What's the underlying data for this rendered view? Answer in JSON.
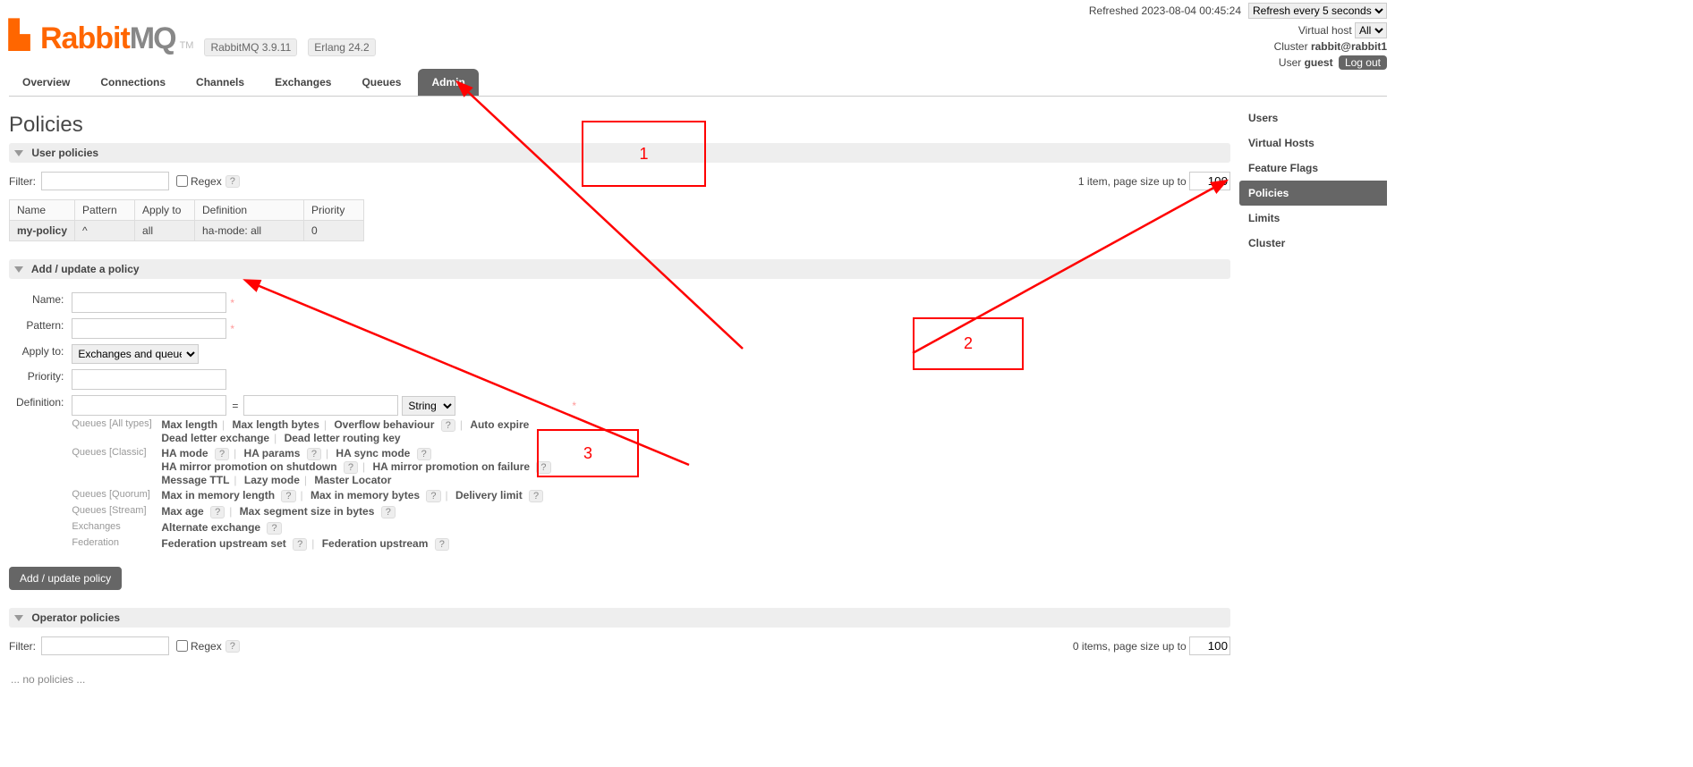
{
  "header": {
    "refreshed_label": "Refreshed 2023-08-04 00:45:24",
    "refresh_select": "Refresh every 5 seconds",
    "vhost_label": "Virtual host",
    "vhost_value": "All",
    "cluster_label": "Cluster",
    "cluster_value": "rabbit@rabbit1",
    "user_label": "User",
    "user_value": "guest",
    "logout": "Log out",
    "rabbit": "Rabbit",
    "mq": "MQ",
    "tm": "TM",
    "version": "RabbitMQ 3.9.11",
    "erlang": "Erlang 24.2"
  },
  "tabs": [
    "Overview",
    "Connections",
    "Channels",
    "Exchanges",
    "Queues",
    "Admin"
  ],
  "rhs": [
    "Users",
    "Virtual Hosts",
    "Feature Flags",
    "Policies",
    "Limits",
    "Cluster"
  ],
  "page_title": "Policies",
  "sections": {
    "user_policies": "User policies",
    "add_update": "Add / update a policy",
    "operator": "Operator policies"
  },
  "filter": {
    "label": "Filter:",
    "regex": "Regex",
    "help": "?"
  },
  "user_pager": {
    "text": "1 item, page size up to",
    "value": "100"
  },
  "op_pager": {
    "text": "0 items, page size up to",
    "value": "100"
  },
  "policy_table": {
    "headers": [
      "Name",
      "Pattern",
      "Apply to",
      "Definition",
      "Priority"
    ],
    "row": {
      "name": "my-policy",
      "pattern": "^",
      "apply": "all",
      "def_key": "ha-mode:",
      "def_val": "all",
      "priority": "0"
    }
  },
  "form": {
    "name_label": "Name:",
    "pattern_label": "Pattern:",
    "apply_label": "Apply to:",
    "apply_value": "Exchanges and queues",
    "priority_label": "Priority:",
    "definition_label": "Definition:",
    "eq": "=",
    "type_value": "String",
    "submit": "Add / update policy"
  },
  "defs": {
    "all_label": "Queues [All types]",
    "all_line1": [
      "Max length",
      "Max length bytes",
      "Overflow behaviour",
      "?",
      "Auto expire"
    ],
    "all_line2": [
      "Dead letter exchange",
      "Dead letter routing key"
    ],
    "classic_label": "Queues [Classic]",
    "classic_line1": [
      "HA mode",
      "?",
      "HA params",
      "?",
      "HA sync mode",
      "?"
    ],
    "classic_line2": [
      "HA mirror promotion on shutdown",
      "?",
      "HA mirror promotion on failure",
      "?"
    ],
    "classic_line3": [
      "Message TTL",
      "Lazy mode",
      "Master Locator"
    ],
    "quorum_label": "Queues [Quorum]",
    "quorum_line": [
      "Max in memory length",
      "?",
      "Max in memory bytes",
      "?",
      "Delivery limit",
      "?"
    ],
    "stream_label": "Queues [Stream]",
    "stream_line": [
      "Max age",
      "?",
      "Max segment size in bytes",
      "?"
    ],
    "ex_label": "Exchanges",
    "ex_line": [
      "Alternate exchange",
      "?"
    ],
    "fed_label": "Federation",
    "fed_line": [
      "Federation upstream set",
      "?",
      "Federation upstream",
      "?"
    ]
  },
  "no_policies": "... no policies ...",
  "annotations": {
    "a1": "1",
    "a2": "2",
    "a3": "3"
  }
}
